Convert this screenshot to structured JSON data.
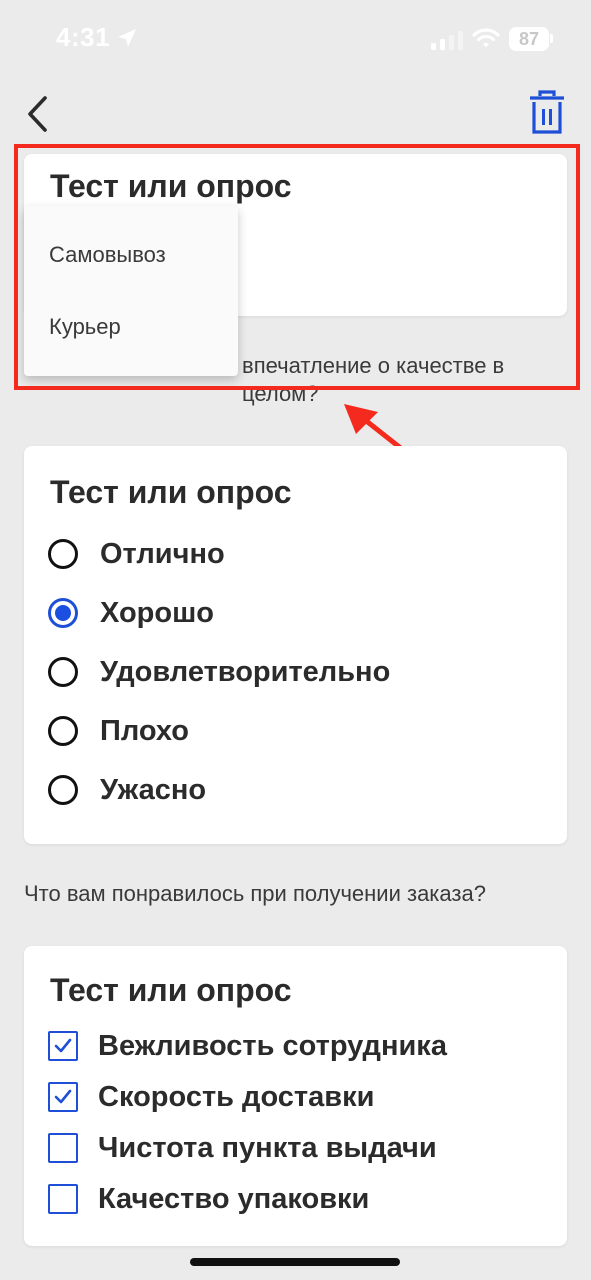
{
  "status_bar": {
    "time": "4:31",
    "battery": "87",
    "icons": [
      "location-arrow-icon",
      "cellular-signal-icon",
      "wifi-icon",
      "battery-icon"
    ]
  },
  "nav": {
    "back_icon": "chevron-left-icon",
    "trash_icon": "trash-icon"
  },
  "colors": {
    "background": "#ebebeb",
    "card": "#ffffff",
    "accent": "#1a4fe0",
    "highlight": "#f52a1e"
  },
  "top_card": {
    "title": "Тест или опрос"
  },
  "dropdown": {
    "items": [
      {
        "label": "Самовывоз"
      },
      {
        "label": "Курьер"
      }
    ]
  },
  "question_1": "впечатление о качестве в целом?",
  "radio_card": {
    "title": "Тест или опрос",
    "options": [
      {
        "label": "Отлично",
        "checked": false
      },
      {
        "label": "Хорошо",
        "checked": true
      },
      {
        "label": "Удовлетворительно",
        "checked": false
      },
      {
        "label": "Плохо",
        "checked": false
      },
      {
        "label": "Ужасно",
        "checked": false
      }
    ]
  },
  "question_2": "Что вам понравилось при получении заказа?",
  "checkbox_card": {
    "title": "Тест или опрос",
    "options": [
      {
        "label": "Вежливость сотрудника",
        "checked": true
      },
      {
        "label": "Скорость доставки",
        "checked": true
      },
      {
        "label": "Чистота пункта выдачи",
        "checked": false
      },
      {
        "label": "Качество упаковки",
        "checked": false
      }
    ]
  }
}
